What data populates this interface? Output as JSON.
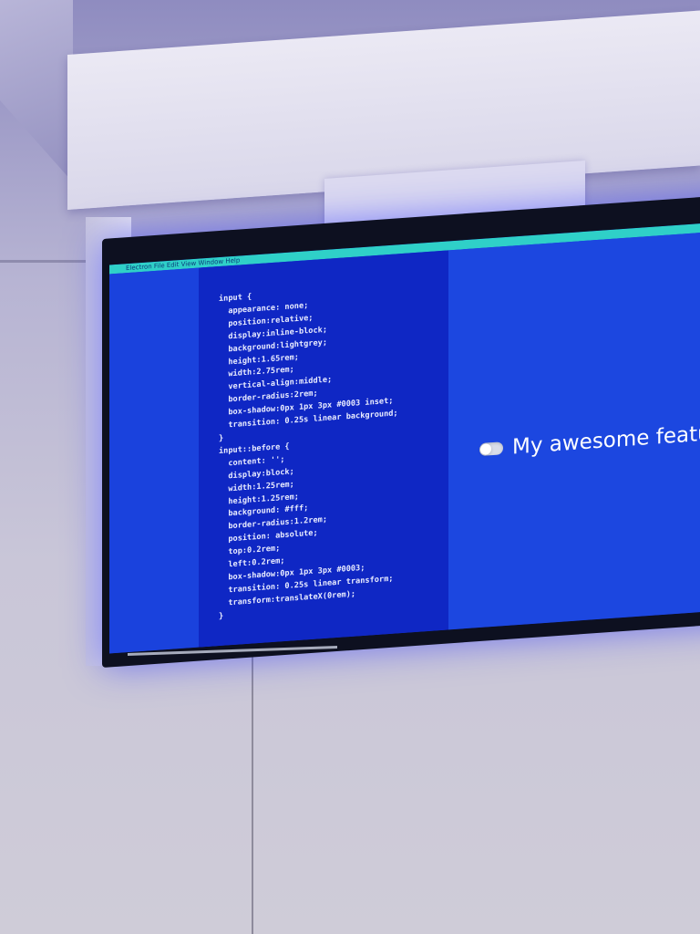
{
  "screen": {
    "menu_text": "Electron  File  Edit  View  Window  Help",
    "code_lines": [
      "input {",
      "  appearance: none;",
      "  position:relative;",
      "  display:inline-block;",
      "  background:lightgrey;",
      "  height:1.65rem;",
      "  width:2.75rem;",
      "  vertical-align:middle;",
      "  border-radius:2rem;",
      "  box-shadow:0px 1px 3px #0003 inset;",
      "  transition: 0.25s linear background;",
      "}",
      "input::before {",
      "  content: '';",
      "  display:block;",
      "  width:1.25rem;",
      "  height:1.25rem;",
      "  background: #fff;",
      "  border-radius:1.2rem;",
      "  position: absolute;",
      "  top:0.2rem;",
      "  left:0.2rem;",
      "  box-shadow:0px 1px 3px #0003;",
      "  transition: 0.25s linear transform;",
      "  transform:translateX(0rem);",
      "}"
    ],
    "preview": {
      "label": "My awesome featu",
      "toggle_on": false
    }
  },
  "colors": {
    "screen_blue": "#1a37d6",
    "editor_blue": "#0f27c4",
    "menubar_cyan": "#2fd0c8",
    "code_text": "#e9ecff"
  }
}
